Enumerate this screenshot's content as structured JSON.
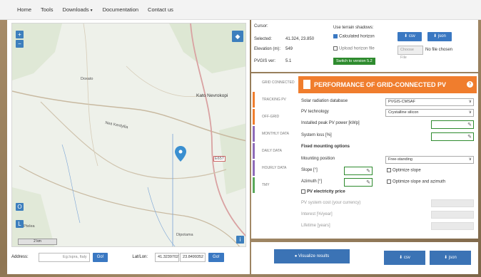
{
  "nav": {
    "items": [
      "Home",
      "Tools",
      "Downloads",
      "Documentation",
      "Contact us"
    ]
  },
  "map": {
    "labels": [
      "Doxato",
      "Kato Nevrokopi",
      "Nea Kerdyllia",
      "E657",
      "Ptelea",
      "Dipotama"
    ],
    "scale": "2 km",
    "zoom_in": "+",
    "zoom_out": "−",
    "btn_o": "O",
    "btn_l": "L",
    "info_btn": "i"
  },
  "address": {
    "label": "Address:",
    "placeholder": "Eg.Ispra, Italy",
    "go": "Go!",
    "latlon_label": "Lat/Lon:",
    "lat": "41.3239702",
    "lon": "23.8499352",
    "go2": "Go!"
  },
  "info": {
    "cursor_label": "Cursor:",
    "selected_label": "Selected:",
    "selected_value": "41.324, 23.850",
    "elevation_label": "Elevation (m):",
    "elevation_value": "549",
    "pvgis_label": "PVGIS ver:",
    "pvgis_value": "5.1",
    "switch": "Switch to version 5.2",
    "terrain_title": "Use terrain shadows:",
    "calc_horizon": "Calculated horizon",
    "upload_horizon": "Upload horizon file",
    "csv": "csv",
    "json": "json",
    "choose_file": "Choose File",
    "no_file": "No file chosen"
  },
  "tabs": [
    "GRID CONNECTED",
    "TRACKING PV",
    "OFF-GRID",
    "MONTHLY DATA",
    "DAILY DATA",
    "HOURLY DATA",
    "TMY"
  ],
  "tool": {
    "title": "PERFORMANCE OF GRID-CONNECTED PV",
    "help": "?",
    "solar_db_label": "Solar radiation database",
    "solar_db_value": "PVGIS-CMSAF",
    "pv_tech_label": "PV technology",
    "pv_tech_value": "Crystalline silicon",
    "peak_power_label": "Installed peak PV power [kWp]",
    "system_loss_label": "System loss [%]",
    "fixed_mounting": "Fixed mounting options",
    "mounting_label": "Mounting position",
    "mounting_value": "Free-standing",
    "slope_label": "Slope [°]",
    "optimize_slope": "Optimize slope",
    "azimuth_label": "Azimuth [°]",
    "optimize_both": "Optimize slope and azimuth",
    "pv_price": "PV electricity price",
    "pv_cost_label": "PV system cost (your currency)",
    "interest_label": "Interest [%/year]",
    "lifetime_label": "Lifetime [years]"
  },
  "bottom": {
    "visualize": "Visualize results",
    "csv": "csv",
    "json": "json"
  },
  "colors": {
    "accent_orange": "#f07d2d",
    "accent_blue": "#3a78c2",
    "accent_green": "#2e8b2e"
  }
}
